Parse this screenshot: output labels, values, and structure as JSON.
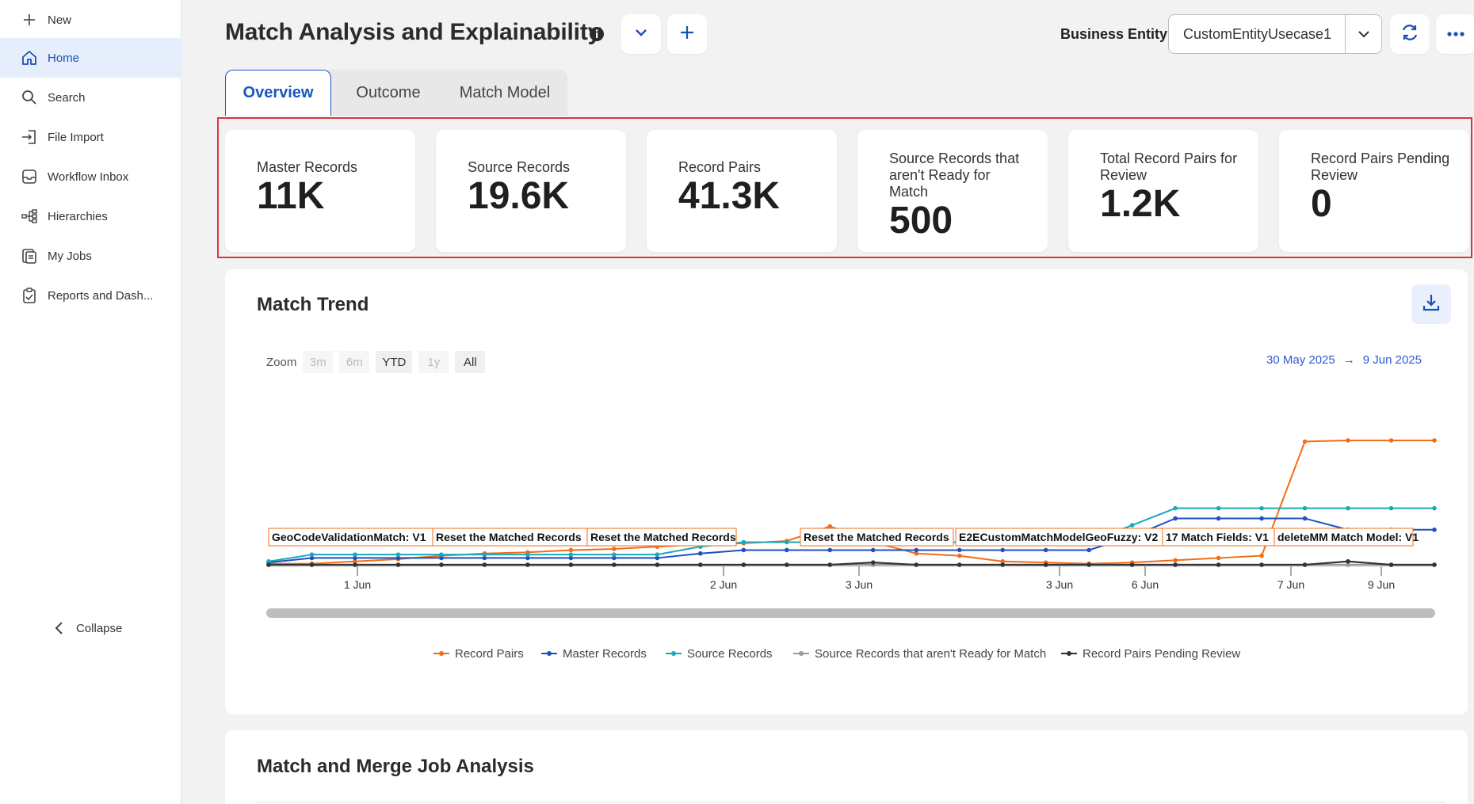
{
  "sidebar": {
    "new_label": "New",
    "items": [
      {
        "label": "Home",
        "icon": "home-icon"
      },
      {
        "label": "Search",
        "icon": "search-icon"
      },
      {
        "label": "File Import",
        "icon": "file-import-icon"
      },
      {
        "label": "Workflow Inbox",
        "icon": "inbox-icon"
      },
      {
        "label": "Hierarchies",
        "icon": "hierarchy-icon"
      },
      {
        "label": "My Jobs",
        "icon": "jobs-icon"
      },
      {
        "label": "Reports and Dash...",
        "icon": "reports-icon"
      }
    ],
    "collapse_label": "Collapse"
  },
  "header": {
    "title": "Match Analysis and Explainability",
    "business_entity_label": "Business Entity:",
    "business_entity_value": "CustomEntityUsecase1"
  },
  "tabs": [
    {
      "label": "Overview",
      "active": true
    },
    {
      "label": "Outcome",
      "active": false
    },
    {
      "label": "Match Model",
      "active": false
    }
  ],
  "kpis": [
    {
      "label": "Master Records",
      "value": "11K"
    },
    {
      "label": "Source Records",
      "value": "19.6K"
    },
    {
      "label": "Record Pairs",
      "value": "41.3K"
    },
    {
      "label": "Source Records that aren't Ready for Match",
      "value": "500"
    },
    {
      "label": "Total Record Pairs for Review",
      "value": "1.2K"
    },
    {
      "label": "Record Pairs Pending Review",
      "value": "0"
    }
  ],
  "chart_section": {
    "title": "Match Trend",
    "zoom_label": "Zoom",
    "zoom_options": [
      "3m",
      "6m",
      "YTD",
      "1y",
      "All"
    ],
    "zoom_enabled": [
      "YTD",
      "All"
    ],
    "date_from": "30 May 2025",
    "date_arrow": "→",
    "date_to": "9 Jun 2025"
  },
  "chart_data": {
    "type": "line",
    "x_tick_labels": [
      "1 Jun",
      "2 Jun",
      "3 Jun",
      "3 Jun",
      "6 Jun",
      "7 Jun",
      "9 Jun"
    ],
    "annotations": [
      "GeoCodeValidationMatch: V1",
      "Reset the Matched Records",
      "Reset the Matched Records",
      "Reset the Matched Records",
      "E2ECustomMatchModelGeoFuzzy: V2",
      "17 Match Fields: V1",
      "deleteMM Match Model: V1"
    ],
    "legend_position": "bottom",
    "series": [
      {
        "name": "Record Pairs",
        "color": "#f36c16",
        "values": [
          0.1,
          0.1,
          0.3,
          0.5,
          0.8,
          1.0,
          1.1,
          1.3,
          1.4,
          1.6,
          1.8,
          1.9,
          2.1,
          3.4,
          2.0,
          1.0,
          0.8,
          0.3,
          0.2,
          0.1,
          0.2,
          0.4,
          0.6,
          0.8,
          10.9,
          11.0,
          11.0,
          11.0
        ]
      },
      {
        "name": "Master Records",
        "color": "#1f4fc4",
        "values": [
          0.2,
          0.6,
          0.6,
          0.6,
          0.6,
          0.6,
          0.6,
          0.6,
          0.6,
          0.6,
          1.0,
          1.3,
          1.3,
          1.3,
          1.3,
          1.3,
          1.3,
          1.3,
          1.3,
          1.3,
          2.5,
          4.1,
          4.1,
          4.1,
          4.1,
          3.1,
          3.1,
          3.1
        ]
      },
      {
        "name": "Source Records",
        "color": "#19a9bd",
        "values": [
          0.3,
          0.9,
          0.9,
          0.9,
          0.9,
          0.9,
          0.9,
          0.9,
          0.9,
          0.9,
          1.6,
          2.0,
          2.0,
          2.0,
          2.0,
          2.0,
          2.0,
          2.0,
          2.0,
          2.0,
          3.5,
          5.0,
          5.0,
          5.0,
          5.0,
          5.0,
          5.0,
          5.0
        ]
      },
      {
        "name": "Source Records that aren't Ready for Match",
        "color": "#9a9a9a",
        "values": [
          0.0,
          0.0,
          0.0,
          0.0,
          0.0,
          0.0,
          0.0,
          0.0,
          0.0,
          0.0,
          0.0,
          0.0,
          0.0,
          0.0,
          0.0,
          0.0,
          0.0,
          0.0,
          0.0,
          0.0,
          0.0,
          0.0,
          0.0,
          0.0,
          0.0,
          0.0,
          0.0,
          0.0
        ]
      },
      {
        "name": "Record Pairs Pending Review",
        "color": "#333333",
        "values": [
          0.0,
          0.0,
          0.0,
          0.0,
          0.0,
          0.0,
          0.0,
          0.0,
          0.0,
          0.0,
          0.0,
          0.0,
          0.0,
          0.0,
          0.2,
          0.0,
          0.0,
          0.0,
          0.0,
          0.0,
          0.0,
          0.0,
          0.0,
          0.0,
          0.0,
          0.3,
          0.0,
          0.0
        ]
      }
    ]
  },
  "second_section": {
    "title": "Match and Merge Job Analysis"
  }
}
